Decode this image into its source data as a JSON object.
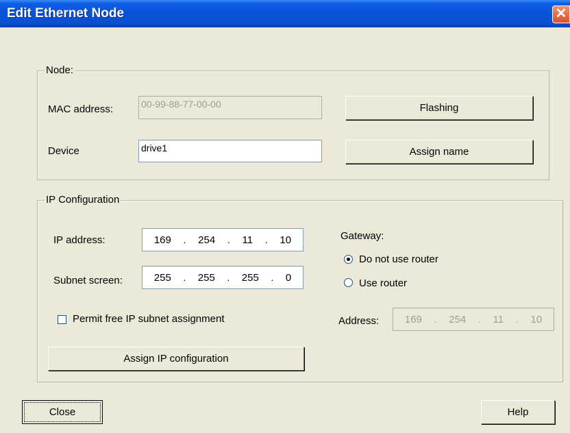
{
  "window": {
    "title": "Edit Ethernet Node",
    "close_glyph": "✕"
  },
  "node": {
    "group_label": "Node:",
    "mac_label": "MAC address:",
    "mac_value": "00-99-88-77-00-00",
    "device_label": "Device",
    "device_value": "drive1",
    "flashing_button": "Flashing",
    "assign_name_button": "Assign name"
  },
  "ip_config": {
    "group_label": "IP Configuration",
    "ip_label": "IP address:",
    "ip_octets": [
      "169",
      "254",
      "11",
      "10"
    ],
    "subnet_label": "Subnet screen:",
    "subnet_octets": [
      "255",
      "255",
      "255",
      "0"
    ],
    "gateway_label": "Gateway:",
    "radio_no_router": "Do not use router",
    "radio_use_router": "Use router",
    "selected_radio": "Do not use router",
    "address_label": "Address:",
    "address_octets": [
      "169",
      "254",
      "11",
      "10"
    ],
    "permit_checkbox_label": "Permit free IP subnet assignment",
    "permit_checked": false,
    "assign_ip_button": "Assign IP configuration"
  },
  "footer": {
    "close_button": "Close",
    "help_button": "Help"
  }
}
